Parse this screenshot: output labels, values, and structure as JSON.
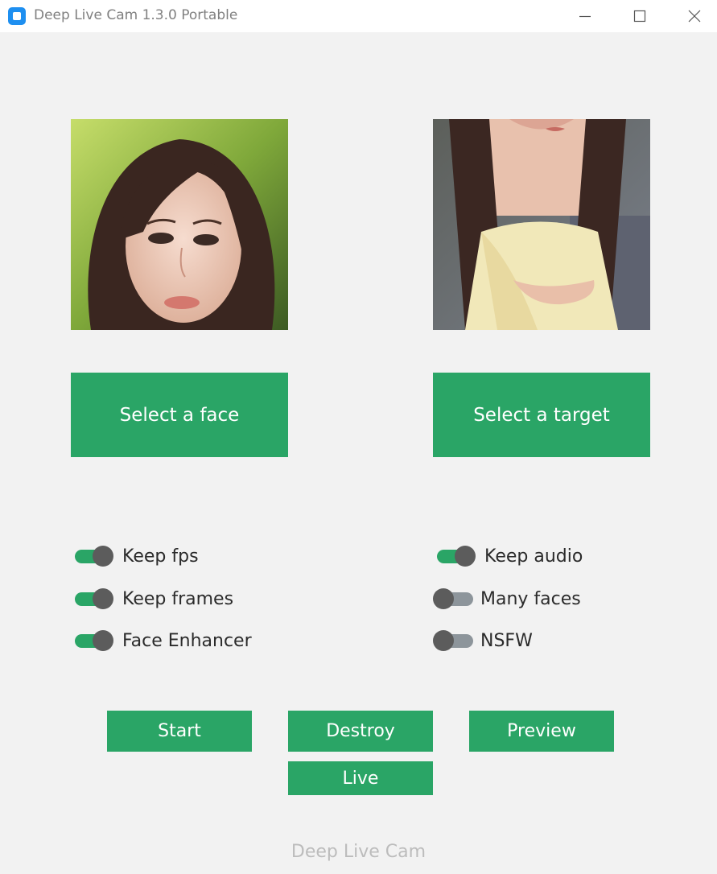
{
  "window": {
    "title": "Deep Live Cam 1.3.0 Portable",
    "minimize_icon": "minimize-icon",
    "maximize_icon": "maximize-icon",
    "close_icon": "close-icon"
  },
  "source_preview": {
    "kind": "face-photo"
  },
  "target_preview": {
    "kind": "target-photo"
  },
  "buttons": {
    "select_face": "Select a face",
    "select_target": "Select a target",
    "start": "Start",
    "destroy": "Destroy",
    "preview": "Preview",
    "live": "Live"
  },
  "switches": {
    "left": [
      {
        "label": "Keep fps",
        "on": true
      },
      {
        "label": "Keep frames",
        "on": true
      },
      {
        "label": "Face Enhancer",
        "on": true
      }
    ],
    "right": [
      {
        "label": "Keep audio",
        "on": true
      },
      {
        "label": "Many faces",
        "on": false
      },
      {
        "label": "NSFW",
        "on": false
      }
    ]
  },
  "footer": {
    "text": "Deep Live Cam"
  },
  "colors": {
    "accent": "#2aa566",
    "switch_off_track": "#8d959b",
    "knob": "#5c5c5c",
    "background": "#f2f2f2"
  }
}
